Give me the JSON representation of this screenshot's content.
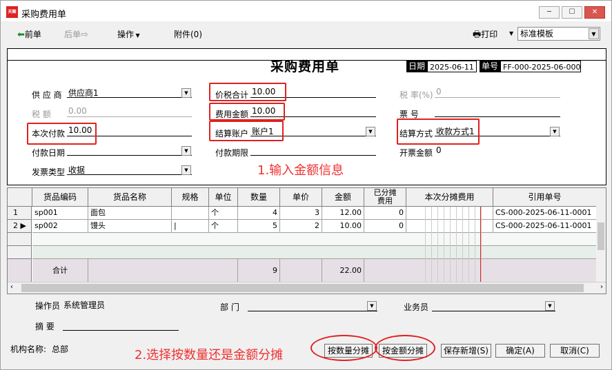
{
  "window": {
    "title": "采购费用单",
    "icon_text": "天顺",
    "min": "─",
    "max": "☐",
    "close": "✕"
  },
  "toolbar": {
    "prev": "前单",
    "next": "后单",
    "ops": "操作",
    "attach": "附件(0)",
    "print": "打印",
    "template": "标准模板"
  },
  "header": {
    "title": "采购费用单",
    "date_label": "日期",
    "date_value": "2025-06-11",
    "no_label": "单号",
    "no_value": "FF-000-2025-06-0001",
    "supplier_label": "供 应 商",
    "supplier_value": "供应商1",
    "total_tax_label": "价税合计",
    "total_tax_value": "10.00",
    "tax_rate_label": "税 率(%)",
    "tax_rate_value": "0",
    "tax_amount_label": "税    额",
    "tax_amount_value": "0.00",
    "fee_amount_label": "费用金额",
    "fee_amount_value": "10.00",
    "ticket_no_label": "票    号",
    "ticket_no_value": "",
    "pay_now_label": "本次付款",
    "pay_now_value": "10.00",
    "account_label": "结算账户",
    "account_value": "账户1",
    "method_label": "结算方式",
    "method_value": "收款方式1",
    "pay_date_label": "付款日期",
    "pay_date_value": "",
    "pay_period_label": "付款期限",
    "pay_period_value": "",
    "invoice_amount_label": "开票金额",
    "invoice_amount_value": "0",
    "invoice_type_label": "发票类型",
    "invoice_type_value": "收据"
  },
  "annotation1": "1.输入金额信息",
  "annotation2": "2.选择按数量还是金额分摊",
  "grid": {
    "columns": [
      "货品编码",
      "货品名称",
      "规格",
      "单位",
      "数量",
      "单价",
      "金额",
      "已分摊费用",
      "本次分摊费用",
      "引用单号"
    ],
    "rows": [
      {
        "idx": "1",
        "marker": "",
        "code": "sp001",
        "name": "面包",
        "spec": "",
        "unit": "个",
        "qty": "4",
        "price": "3",
        "amount": "12.00",
        "allocated": "0",
        "ref": "CS-000-2025-06-11-0001"
      },
      {
        "idx": "2",
        "marker": "▶",
        "code": "sp002",
        "name": "馒头",
        "spec": "|",
        "unit": "个",
        "qty": "5",
        "price": "2",
        "amount": "10.00",
        "allocated": "0",
        "ref": "CS-000-2025-06-11-0001"
      }
    ],
    "total_label": "合计",
    "total_qty": "9",
    "total_amount": "22.00"
  },
  "footer": {
    "operator_label": "操作员",
    "operator_value": "系统管理员",
    "dept_label": "部    门",
    "dept_value": "",
    "salesman_label": "业务员",
    "salesman_value": "",
    "summary_label": "摘    要",
    "summary_value": "",
    "org_label": "机构名称:",
    "org_value": "总部"
  },
  "buttons": {
    "by_qty": "按数量分摊",
    "by_amount": "按金额分摊",
    "save_new": "保存新增(S)",
    "ok": "确定(A)",
    "cancel": "取消(C)"
  }
}
